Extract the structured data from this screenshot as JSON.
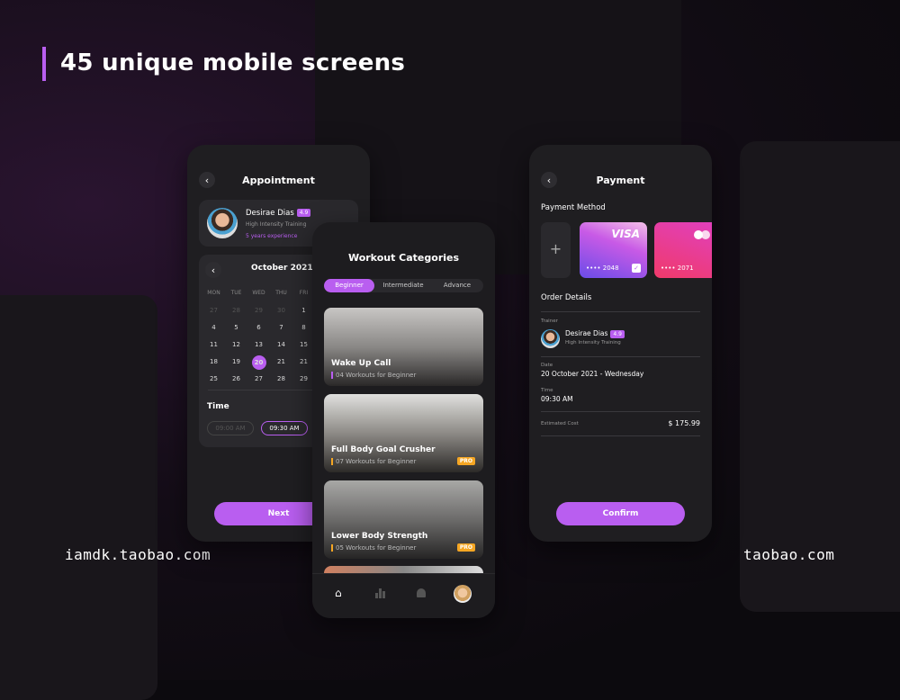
{
  "heading": "45 unique mobile screens",
  "watermark": "iamdk.taobao.com",
  "watermark_partial": "taobao.com",
  "accent": "#b95ef0",
  "pro_color": "#f5a623",
  "appointment": {
    "title": "Appointment",
    "trainer": {
      "name": "Desirae Dias",
      "rating": "4.9",
      "specialty": "High Intensity Training",
      "experience": "5 years experience"
    },
    "month": "October 2021",
    "weekdays": [
      "MON",
      "TUE",
      "WED",
      "THU",
      "FRI"
    ],
    "days": [
      [
        "27",
        "28",
        "29",
        "30",
        "1"
      ],
      [
        "4",
        "5",
        "6",
        "7",
        "8"
      ],
      [
        "11",
        "12",
        "13",
        "14",
        "15"
      ],
      [
        "18",
        "19",
        "20",
        "21",
        "21"
      ],
      [
        "25",
        "26",
        "27",
        "28",
        "29"
      ]
    ],
    "selected_day": "20",
    "time_label": "Time",
    "times": [
      "09:00 AM",
      "09:30 AM"
    ],
    "selected_time": "09:30 AM",
    "next": "Next"
  },
  "workout": {
    "title": "Workout Categories",
    "tabs": [
      "Beginner",
      "Intermediate",
      "Advance"
    ],
    "active_tab": "Beginner",
    "items": [
      {
        "name": "Wake Up Call",
        "sub": "04 Workouts  for Beginner",
        "pro": ""
      },
      {
        "name": "Full Body Goal Crusher",
        "sub": "07 Workouts  for Beginner",
        "pro": "PRO"
      },
      {
        "name": "Lower Body Strength",
        "sub": "05 Workouts  for Beginner",
        "pro": "PRO"
      }
    ],
    "nav": [
      "home-icon",
      "chart-icon",
      "bell-icon",
      "profile-avatar"
    ]
  },
  "payment": {
    "title": "Payment",
    "method_label": "Payment Method",
    "cards": [
      {
        "brand": "VISA",
        "number": "•••• 2048",
        "selected": true
      },
      {
        "brand": "mastercard",
        "number": "•••• 2071",
        "selected": false
      }
    ],
    "order_label": "Order Details",
    "trainer_label": "Trainer",
    "trainer_name": "Desirae Dias",
    "trainer_rating": "4.9",
    "trainer_specialty": "High Intensity Training",
    "date_label": "Date",
    "date": "20 October 2021 - Wednesday",
    "time_label": "Time",
    "time": "09:30 AM",
    "cost_label": "Estimated Cost",
    "cost": "$ 175.99",
    "confirm": "Confirm"
  }
}
